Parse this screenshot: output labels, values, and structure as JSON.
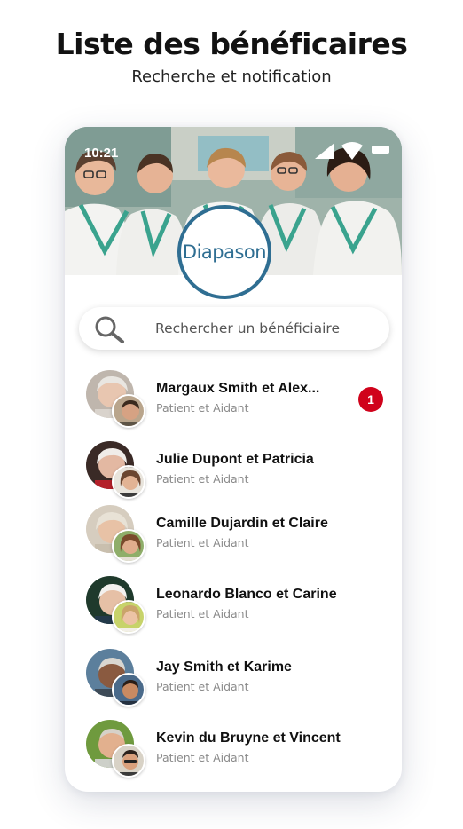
{
  "header": {
    "title": "Liste des bénéficaires",
    "subtitle": "Recherche et notification"
  },
  "status_bar": {
    "time": "10:21",
    "icons": [
      "signal-icon",
      "wifi-icon",
      "battery-icon"
    ]
  },
  "brand": {
    "logo_text": "Diapason",
    "color": "#2f6e92"
  },
  "search": {
    "placeholder": "Rechercher un bénéficiaire",
    "icon": "search-icon"
  },
  "beneficiaries": [
    {
      "name": "Margaux Smith et Alex...",
      "role": "Patient et Aidant",
      "notifications": "1"
    },
    {
      "name": "Julie Dupont et Patricia",
      "role": "Patient et Aidant"
    },
    {
      "name": "Camille Dujardin et Claire",
      "role": "Patient et Aidant"
    },
    {
      "name": "Leonardo Blanco et Carine",
      "role": "Patient et Aidant"
    },
    {
      "name": "Jay Smith et Karime",
      "role": "Patient et Aidant"
    },
    {
      "name": "Kevin du Bruyne et Vincent",
      "role": "Patient et Aidant"
    }
  ],
  "colors": {
    "badge": "#d0021b",
    "subtitle_text": "#8a8a8a"
  }
}
